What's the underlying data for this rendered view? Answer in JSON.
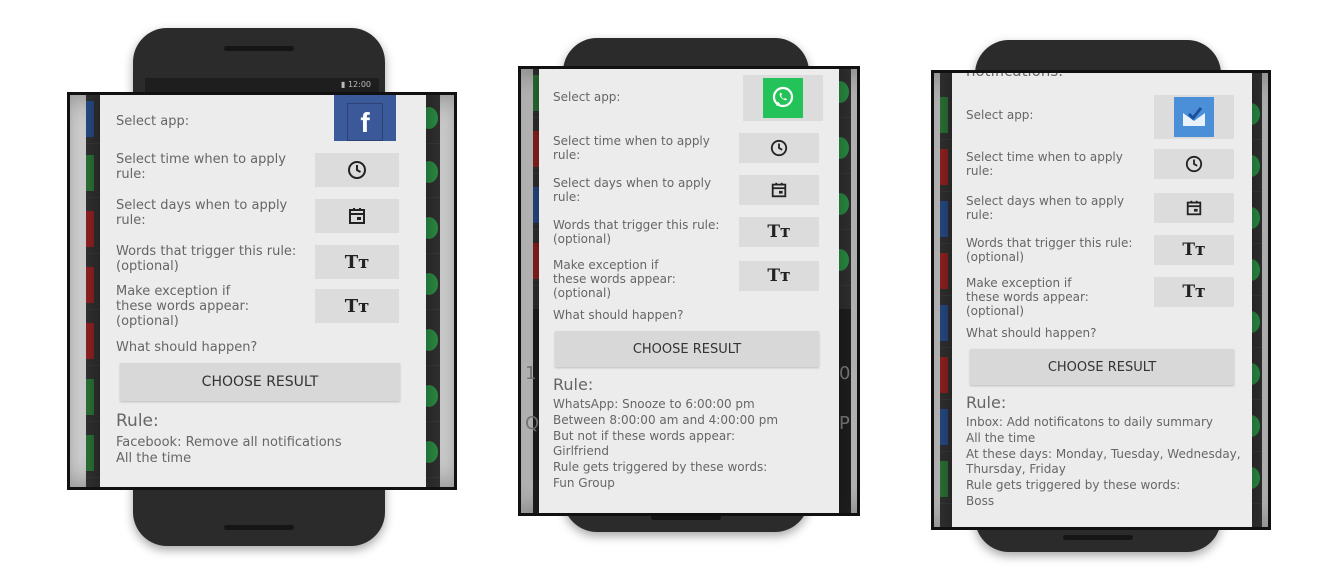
{
  "screens": [
    {
      "select_app_label": "Select app:",
      "app_icon": "facebook-icon",
      "time_label": "Select time when to apply\nrule:",
      "days_label": "Select days when to apply\nrule:",
      "words_label": "Words that trigger this rule:\n(optional)",
      "exception_label": "Make exception if\nthese words appear:\n(optional)",
      "happen_label": "What should happen?",
      "choose_button": "CHOOSE RESULT",
      "rule_heading": "Rule:",
      "rule_text": "Facebook: Remove all notifications\nAll the time",
      "text_icon_glyph": "Tт",
      "fb_glyph": "f"
    },
    {
      "select_app_label": "Select app:",
      "app_icon": "whatsapp-icon",
      "time_label": "Select time when to apply\nrule:",
      "days_label": "Select days when to apply\nrule:",
      "words_label": "Words that trigger this rule:\n(optional)",
      "exception_label": "Make exception if\nthese words appear:\n(optional)",
      "happen_label": "What should happen?",
      "choose_button": "CHOOSE RESULT",
      "rule_heading": "Rule:",
      "rule_text": "WhatsApp: Snooze to 6:00:00 pm\nBetween 8:00:00 am and 4:00:00 pm\nBut not if these words appear:\nGirlfriend\nRule gets triggered by these words:\nFun Group",
      "text_icon_glyph": "Tт",
      "bg_left_1": "1",
      "bg_right_1": "0",
      "bg_left_2": "Q",
      "bg_right_2": "P"
    },
    {
      "top_cut_text": "notifications:",
      "select_app_label": "Select app:",
      "app_icon": "inbox-icon",
      "time_label": "Select time when to apply\nrule:",
      "days_label": "Select days when to apply\nrule:",
      "words_label": "Words that trigger this rule:\n(optional)",
      "exception_label": "Make exception if\nthese words appear:\n(optional)",
      "happen_label": "What should happen?",
      "choose_button": "CHOOSE RESULT",
      "rule_heading": "Rule:",
      "rule_text": "Inbox: Add notificatons to daily summary\nAll the time\nAt these days: Monday, Tuesday, Wednesday,\nThursday, Friday\nRule gets triggered by these words:\nBoss",
      "text_icon_glyph": "Tт"
    }
  ],
  "colors": {
    "facebook": "#3a5a99",
    "whatsapp": "#24c35a",
    "inbox": "#4b8fd8",
    "stripe_green": "#2f7a3a",
    "stripe_red": "#9a2424",
    "stripe_blue": "#2a4f8f"
  }
}
